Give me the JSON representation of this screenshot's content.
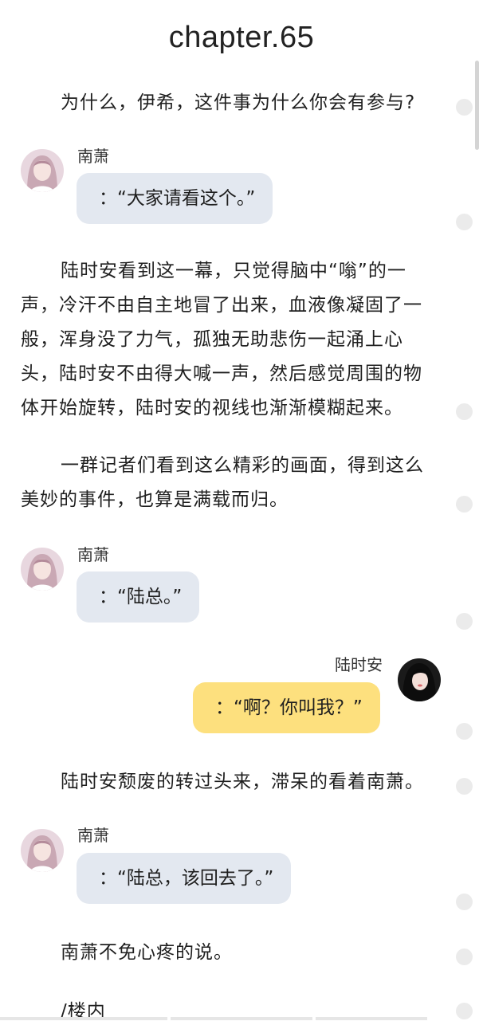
{
  "chapter": {
    "title": "chapter.65"
  },
  "paragraphs": [
    "为什么，伊希，这件事为什么你会有参与?",
    "陆时安看到这一幕，只觉得脑中“嗡”的一声，冷汗不由自主地冒了出来，血液像凝固了一般，浑身没了力气，孤独无助悲伤一起涌上心头，陆时安不由得大喊一声，然后感觉周围的物体开始旋转，陆时安的视线也渐渐模糊起来。",
    "一群记者们看到这么精彩的画面，得到这么美妙的事件，也算是满载而归。",
    "陆时安颓废的转过头来，滞呆的看着南萧。",
    "南萧不免心疼的说。",
    "/楼内"
  ],
  "dialogs": [
    {
      "speaker": "南萧",
      "text": "：“大家请看这个。”"
    },
    {
      "speaker": "南萧",
      "text": "：“陆总。”"
    },
    {
      "speaker": "陆时安",
      "text": "：“啊？你叫我？”"
    },
    {
      "speaker": "南萧",
      "text": "：“陆总，该回去了。”"
    }
  ],
  "avatars": {
    "nanxiao": "girl-portrait-avatar",
    "lushian": "dark-hair-portrait-avatar"
  },
  "colors": {
    "bubble_gray": "#e3e8f0",
    "bubble_yellow": "#fde07e",
    "side_dot": "#ebebeb"
  }
}
